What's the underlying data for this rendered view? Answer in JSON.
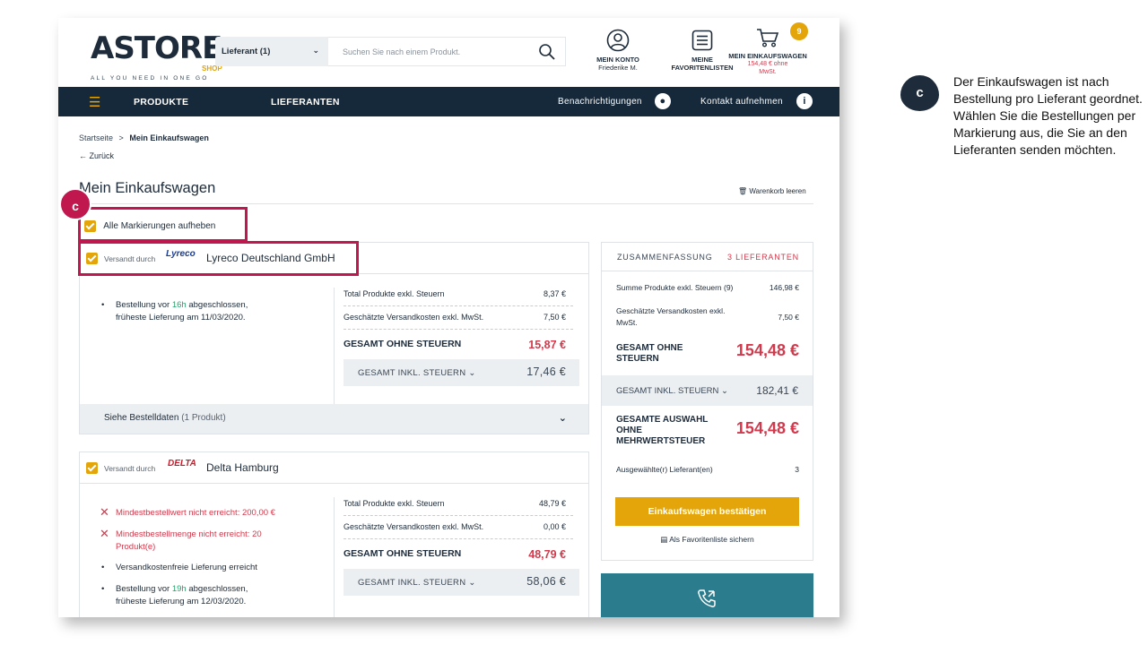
{
  "header": {
    "logo_main": "ASTORE",
    "logo_shop": "SHOP",
    "logo_tagline": "ALL YOU NEED IN ONE GO",
    "supplier_select": "Lieferant (1)",
    "search_placeholder": "Suchen Sie nach einem Produkt.",
    "account_label": "MEIN KONTO",
    "account_user": "Friederike M.",
    "favorites_label_1": "MEINE",
    "favorites_label_2": "FAVORITENLISTEN",
    "cart_label": "MEIN EINKAUFSWAGEN",
    "cart_total_1": "154,48 € ohne",
    "cart_total_2": "MwSt.",
    "cart_count": "9"
  },
  "nav": {
    "products": "PRODUKTE",
    "suppliers": "LIEFERANTEN",
    "notifications": "Benachrichtigungen",
    "contact": "Kontakt aufnehmen"
  },
  "breadcrumb": {
    "home": "Startseite",
    "sep": ">",
    "current": "Mein Einkaufswagen"
  },
  "back_label": "Zurück",
  "page_title": "Mein Einkaufswagen",
  "empty_cart_label": "Warenkorb leeren",
  "select_all_label": "Alle Markierungen aufheben",
  "orders": [
    {
      "shipped_by": "Versandt durch",
      "logo_text": "Lyreco",
      "supplier": "Lyreco Deutschland GmbH",
      "notes": [
        {
          "pre": "Bestellung vor ",
          "hl": "16h",
          "post": " abgeschlossen,",
          "line2": "früheste Lieferung am 11/03/2020."
        }
      ],
      "rows": [
        {
          "label": "Total Produkte exkl. Steuern",
          "value": "8,37 €"
        },
        {
          "label": "Geschätzte Versandkosten exkl. MwSt.",
          "value": "7,50 €"
        }
      ],
      "total_label": "GESAMT OHNE STEUERN",
      "total_value": "15,87 €",
      "incl_label": "GESAMT INKL. STEUERN",
      "incl_value": "17,46 €",
      "details_label": "Siehe Bestelldaten",
      "details_count": "(1 Produkt)"
    },
    {
      "shipped_by": "Versandt durch",
      "logo_text": "DELTA",
      "supplier": "Delta Hamburg",
      "errors": [
        "Mindestbestellwert nicht erreicht: 200,00 €",
        "Mindestbestellmenge nicht erreicht: 20",
        "Produkt(e)"
      ],
      "info": "Versandkostenfreie Lieferung erreicht",
      "notes": [
        {
          "pre": "Bestellung vor ",
          "hl": "19h",
          "post": " abgeschlossen,",
          "line2": "früheste Lieferung am 12/03/2020."
        }
      ],
      "rows": [
        {
          "label": "Total Produkte exkl. Steuern",
          "value": "48,79 €"
        },
        {
          "label": "Geschätzte Versandkosten exkl. MwSt.",
          "value": "0,00 €"
        }
      ],
      "total_label": "GESAMT OHNE STEUERN",
      "total_value": "48,79 €",
      "incl_label": "GESAMT INKL. STEUERN",
      "incl_value": "58,06 €"
    }
  ],
  "summary": {
    "title": "ZUSAMMENFASSUNG",
    "suppliers": "3 LIEFERANTEN",
    "products_label": "Summe Produkte exkl. Steuern (9)",
    "products_value": "146,98 €",
    "shipping_label_1": "Geschätzte Versandkosten exkl.",
    "shipping_label_2": "MwSt.",
    "shipping_value": "7,50 €",
    "total_label_1": "GESAMT OHNE",
    "total_label_2": "STEUERN",
    "total_value": "154,48 €",
    "incl_label": "GESAMT INKL. STEUERN",
    "incl_value": "182,41 €",
    "selection_label_1": "GESAMTE AUSWAHL",
    "selection_label_2": "OHNE",
    "selection_label_3": "MEHRWERTSTEUER",
    "selection_value": "154,48 €",
    "selected_suppliers_label": "Ausgewählte(r) Lieferant(en)",
    "selected_suppliers_value": "3",
    "confirm_label": "Einkaufswagen bestätigen",
    "save_fav_label": "Als Favoritenliste sichern"
  },
  "annotation": {
    "marker": "c",
    "text": "Der Einkaufswagen ist nach Bestellung pro Lieferant geordnet. Wählen Sie die Bestellungen per Markierung aus, die Sie an den Lieferanten senden möchten."
  },
  "colors": {
    "navy": "#16293a",
    "accent": "#e3a50a",
    "price_red": "#d13a4c",
    "highlight": "#c0174f",
    "teal": "#2b7c8c"
  }
}
